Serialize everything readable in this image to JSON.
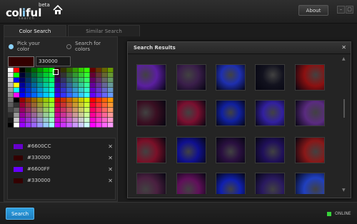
{
  "app": {
    "logo_parts": [
      "col",
      "i",
      "ful"
    ],
    "beta": "beta",
    "subtitle": "search"
  },
  "header": {
    "about_label": "About",
    "minimize_icon": "minimize-icon",
    "maximize_icon": "maximize-icon"
  },
  "tabs": [
    {
      "label": "Color Search",
      "active": true
    },
    {
      "label": "Similar Search",
      "active": false
    }
  ],
  "picker": {
    "radio_pick": "Pick your color",
    "radio_search": "Search for colors",
    "current_hex": "330000",
    "current_color": "#330000"
  },
  "saved_colors": [
    {
      "label": "#6600CC",
      "color": "#6600CC"
    },
    {
      "label": "#330000",
      "color": "#330000"
    },
    {
      "label": "#6600FF",
      "color": "#6600FF"
    },
    {
      "label": "#330000",
      "color": "#330000"
    }
  ],
  "results": {
    "title": "Search Results",
    "close_icon": "close-icon",
    "thumb_colors": [
      [
        "#5b1fa0",
        "#3a1e4a",
        "#1e2fb0",
        "#12121e",
        "#8c1010"
      ],
      [
        "#3a0f22",
        "#7a1030",
        "#1020a0",
        "#3220a0",
        "#5a2b80"
      ],
      [
        "#7a1028",
        "#101090",
        "#2a1040",
        "#20105a",
        "#8a1818"
      ],
      [
        "#4a2040",
        "#60105a",
        "#1020b0",
        "#2a1a60",
        "#2040c0"
      ]
    ]
  },
  "footer": {
    "search_label": "Search",
    "status": "ONLINE"
  },
  "colors": {
    "accent": "#2e9fe0",
    "online": "#37d43a"
  }
}
